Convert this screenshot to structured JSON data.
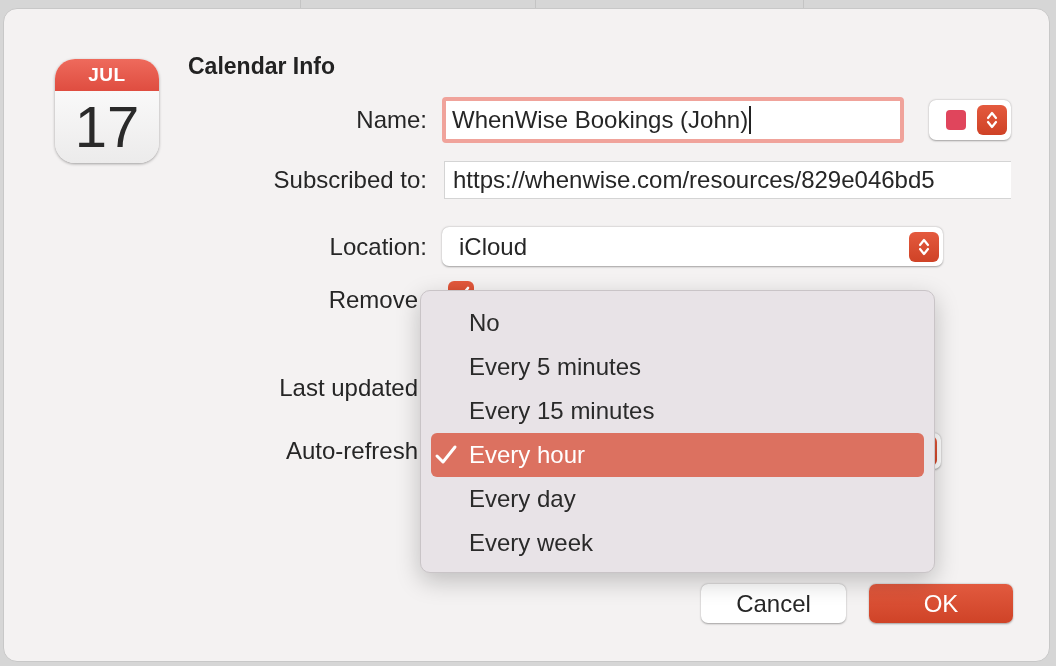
{
  "app_icon": {
    "month": "JUL",
    "day": "17"
  },
  "title": "Calendar Info",
  "name": {
    "label": "Name:",
    "value": "WhenWise Bookings (John)",
    "focused": true
  },
  "calendar_color": {
    "color": "#e0455c"
  },
  "subscribed": {
    "label": "Subscribed to:",
    "value": "https://whenwise.com/resources/829e046bd5"
  },
  "location": {
    "label": "Location:",
    "value": "iCloud"
  },
  "remove": {
    "label": "Remove",
    "checked": true
  },
  "last_updated": {
    "label": "Last updated"
  },
  "auto_refresh": {
    "label": "Auto-refresh"
  },
  "menu": {
    "items": [
      {
        "label": "No",
        "selected": false
      },
      {
        "label": "Every 5 minutes",
        "selected": false
      },
      {
        "label": "Every 15 minutes",
        "selected": false
      },
      {
        "label": "Every hour",
        "selected": true
      },
      {
        "label": "Every day",
        "selected": false
      },
      {
        "label": "Every week",
        "selected": false
      }
    ]
  },
  "buttons": [
    {
      "label": "Cancel",
      "default": false
    },
    {
      "label": "OK",
      "default": true
    }
  ]
}
